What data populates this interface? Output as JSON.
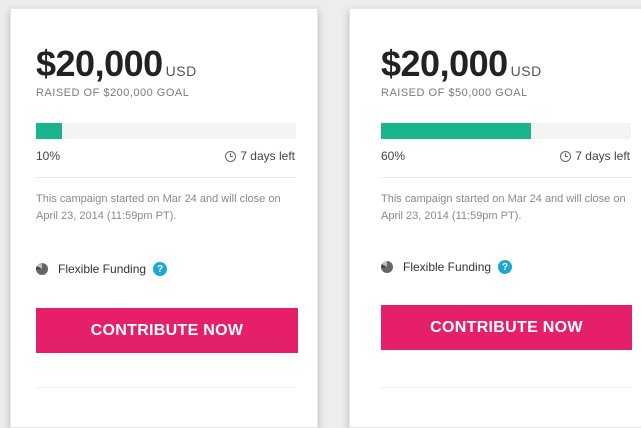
{
  "colors": {
    "progress": "#1ab58d",
    "button": "#e61f6b",
    "help_icon": "#1fa8cf"
  },
  "cards": [
    {
      "amount": "$20,000",
      "currency": "USD",
      "raised_text": "RAISED OF $200,000 GOAL",
      "progress_percent": 10,
      "percent_label": "10%",
      "time_left": "7 days left",
      "description": "This campaign started on Mar 24 and will close on April 23, 2014 (11:59pm PT).",
      "funding_label": "Flexible Funding",
      "help_icon_glyph": "?",
      "button_label": "CONTRIBUTE NOW"
    },
    {
      "amount": "$20,000",
      "currency": "USD",
      "raised_text": "RAISED OF $50,000 GOAL",
      "progress_percent": 60,
      "percent_label": "60%",
      "time_left": "7 days left",
      "description": "This campaign started on Mar 24 and will close on April 23, 2014 (11:59pm PT).",
      "funding_label": "Flexible Funding",
      "help_icon_glyph": "?",
      "button_label": "CONTRIBUTE NOW"
    }
  ]
}
